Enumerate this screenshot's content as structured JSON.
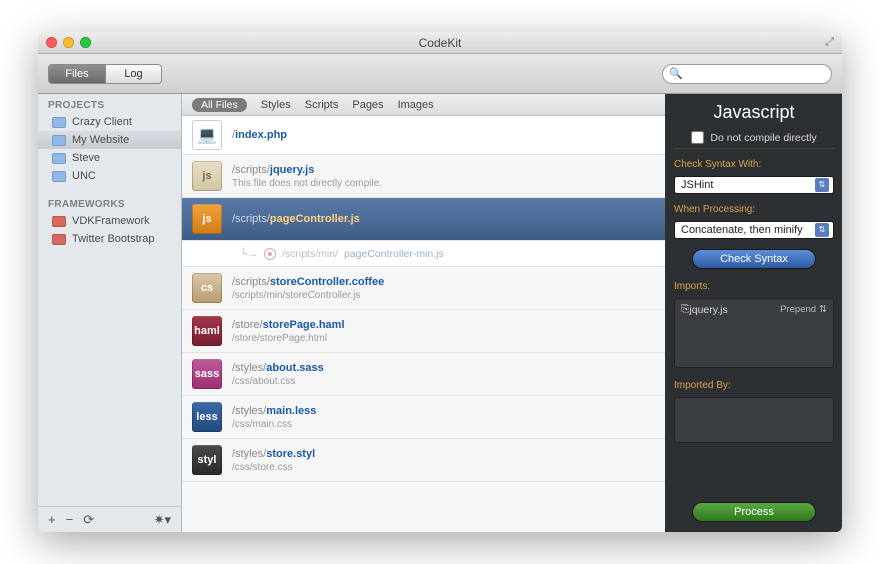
{
  "window": {
    "title": "CodeKit"
  },
  "toolbar": {
    "tabs": {
      "files": "Files",
      "log": "Log"
    },
    "search_placeholder": ""
  },
  "sidebar": {
    "projects_label": "PROJECTS",
    "frameworks_label": "FRAMEWORKS",
    "projects": [
      {
        "name": "Crazy Client"
      },
      {
        "name": "My Website"
      },
      {
        "name": "Steve"
      },
      {
        "name": "UNC"
      }
    ],
    "frameworks": [
      {
        "name": "VDKFramework"
      },
      {
        "name": "Twitter Bootstrap"
      }
    ]
  },
  "filters": {
    "all": "All Files",
    "styles": "Styles",
    "scripts": "Scripts",
    "pages": "Pages",
    "images": "Images"
  },
  "files": [
    {
      "badge": "page",
      "label": "",
      "path_prefix": "/",
      "name": "index.php",
      "sub": ""
    },
    {
      "badge": "js-gray",
      "label": "js",
      "path_prefix": "/scripts/",
      "name": "jquery.js",
      "sub": "This file does not directly compile."
    },
    {
      "badge": "js-orange",
      "label": "js",
      "path_prefix": "/scripts/",
      "name": "pageController.js",
      "sub": "",
      "selected": true,
      "child": {
        "path": "/scripts/min/",
        "name": "pageController-min.js"
      }
    },
    {
      "badge": "cs",
      "label": "cs",
      "path_prefix": "/scripts/",
      "name": "storeController.coffee",
      "sub": "/scripts/min/storeController.js"
    },
    {
      "badge": "haml",
      "label": "haml",
      "path_prefix": "/store/",
      "name": "storePage.haml",
      "sub": "/store/storePage.html"
    },
    {
      "badge": "sass",
      "label": "sass",
      "path_prefix": "/styles/",
      "name": "about.sass",
      "sub": "/css/about.css"
    },
    {
      "badge": "less",
      "label": "less",
      "path_prefix": "/styles/",
      "name": "main.less",
      "sub": "/css/main.css"
    },
    {
      "badge": "styl",
      "label": "styl",
      "path_prefix": "/styles/",
      "name": "store.styl",
      "sub": "/css/store.css"
    }
  ],
  "inspector": {
    "title": "Javascript",
    "dont_compile": "Do not compile directly",
    "check_syntax_label": "Check Syntax With:",
    "check_syntax_value": "JSHint",
    "when_processing_label": "When Processing:",
    "when_processing_value": "Concatenate, then minify",
    "check_syntax_btn": "Check Syntax",
    "imports_label": "Imports:",
    "imports": [
      {
        "name": "jquery.js",
        "mode": "Prepend"
      }
    ],
    "imported_by_label": "Imported By:",
    "process_btn": "Process"
  }
}
